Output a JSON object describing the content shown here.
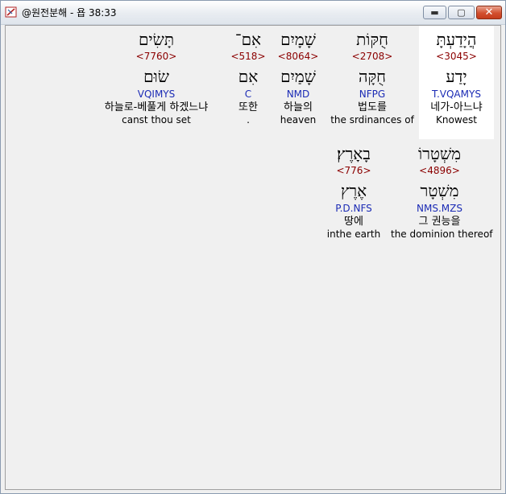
{
  "window": {
    "title": "@원전분해 - 욥 38:33",
    "controls": {
      "minimize": "▬",
      "maximize": "▢",
      "close": "✕"
    }
  },
  "colors": {
    "strong_number": "#8b0000",
    "parsing": "#1b2bb5",
    "highlight": "#ffffff"
  },
  "words": [
    {
      "hebrew": "הֲיָדַעְתָּ",
      "strong": "<3045>",
      "lemma": "יָדַע",
      "parsing": "T.VQAMYS",
      "korean": "네가-아느냐",
      "english": "Knowest",
      "highlighted": true
    },
    {
      "hebrew": "חֻקּוֹת",
      "strong": "<2708>",
      "lemma": "חֻקָּה",
      "parsing": "NFPG",
      "korean": "법도를",
      "english": "the srdinances of",
      "highlighted": false
    },
    {
      "hebrew": "שָׁמָיִם",
      "strong": "<8064>",
      "lemma": "שָׁמַיִם",
      "parsing": "NMD",
      "korean": "하늘의",
      "english": "heaven",
      "highlighted": false
    },
    {
      "hebrew": "אִם־",
      "strong": "<518>",
      "lemma": "אִם",
      "parsing": "C",
      "korean": "또한",
      "english": ".",
      "highlighted": false
    },
    {
      "hebrew": "תָּשִׂים",
      "strong": "<7760>",
      "lemma": "שׂוּם",
      "parsing": "VQIMYS",
      "korean": "하늘로-베풀게 하겠느냐",
      "english": "canst thou set",
      "highlighted": false
    },
    {
      "hebrew": "מִשְׁטָרוֹ",
      "strong": "<4896>",
      "lemma": "מִשְׁטָר",
      "parsing": "NMS.MZS",
      "korean": "그 권능을",
      "english": "the dominion thereof",
      "highlighted": false
    },
    {
      "hebrew": "בָאָרֶץ׃",
      "strong": "<776>",
      "lemma": "אֶרֶץ",
      "parsing": "P.D.NFS",
      "korean": "땅에",
      "english": "inthe earth",
      "highlighted": false
    }
  ]
}
